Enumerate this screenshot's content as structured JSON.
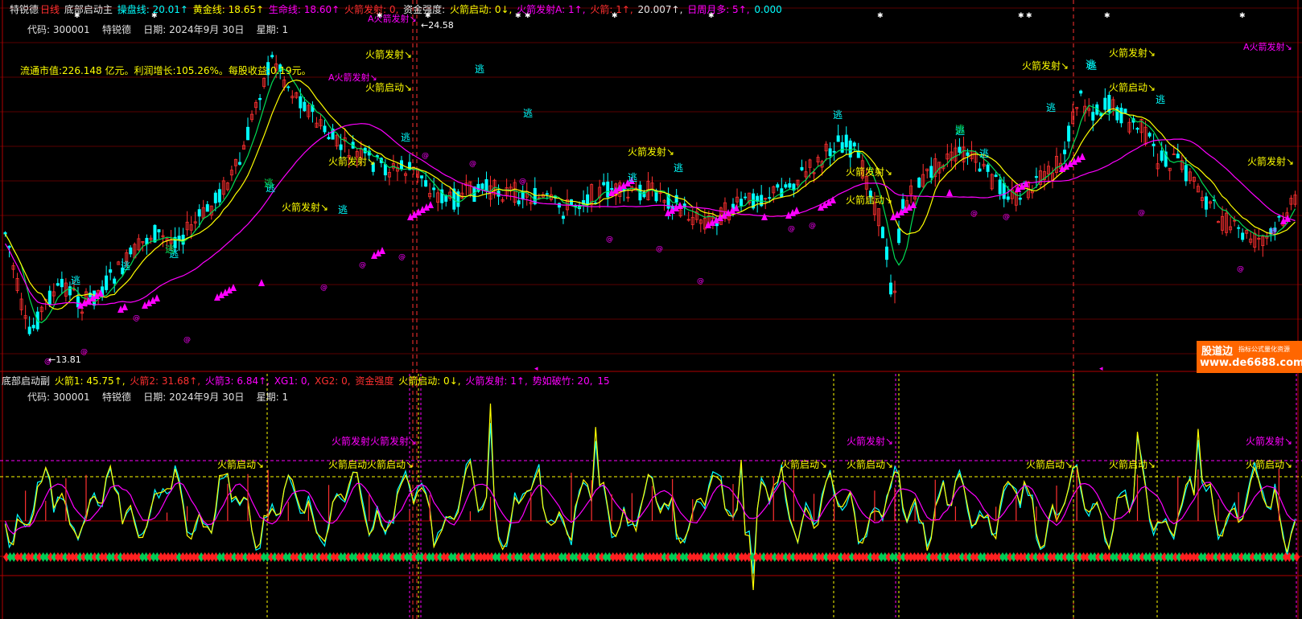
{
  "main_header": {
    "stock": "特锐德",
    "period": "日线",
    "indicator": "底部启动主",
    "items": [
      {
        "label": "操盘线:",
        "value": "20.01",
        "arrow": "↑",
        "color": "#00ffff"
      },
      {
        "label": "黄金线:",
        "value": "18.65",
        "arrow": "↑",
        "color": "#ffff00"
      },
      {
        "label": "生命线:",
        "value": "18.60",
        "arrow": "↑",
        "color": "#ff00ff"
      },
      {
        "label": "火箭发射:",
        "value": "0,",
        "arrow": "",
        "color": "#ff3030"
      },
      {
        "label": "资金强度:",
        "value": "",
        "arrow": "",
        "color": "#e8e8e8"
      },
      {
        "label": "火箭启动:",
        "value": "0",
        "arrow": "↓,",
        "color": "#ffff00"
      },
      {
        "label": "火箭发射A:",
        "value": "1",
        "arrow": "↑,",
        "color": "#ff00ff"
      },
      {
        "label": "火箭:",
        "value": "1",
        "arrow": "↑,",
        "color": "#ff3030"
      },
      {
        "label": "",
        "value": "20.007",
        "arrow": "↑,",
        "color": "#e8e8e8"
      },
      {
        "label": "日周月多:",
        "value": "5",
        "arrow": "↑,",
        "color": "#ff00ff"
      },
      {
        "label": "",
        "value": "0.000",
        "arrow": "",
        "color": "#00ffff"
      }
    ]
  },
  "main_info": {
    "code_label": "代码:",
    "code": "300001",
    "name": "特锐德",
    "date_label": "日期:",
    "date": "2024年9月 30日",
    "week_label": "星期:",
    "week": "1",
    "fundamentals": "流通市值:226.148 亿元。利润增长:105.26%。每股收益:0.19元。"
  },
  "sub_header": {
    "indicator": "底部启动副",
    "items": [
      {
        "label": "火箭1:",
        "value": "45.75",
        "arrow": "↑,",
        "color": "#ffff00"
      },
      {
        "label": "火箭2:",
        "value": "31.68",
        "arrow": "↑,",
        "color": "#ff3030"
      },
      {
        "label": "火箭3:",
        "value": "6.84",
        "arrow": "↑,",
        "color": "#ff00ff"
      },
      {
        "label": "XG1:",
        "value": "0,",
        "arrow": "",
        "color": "#ff00ff"
      },
      {
        "label": "XG2:",
        "value": "0,",
        "arrow": "",
        "color": "#ff3030"
      },
      {
        "label": "资金强度",
        "value": "",
        "arrow": "",
        "color": "#ff3030"
      },
      {
        "label": "火箭启动:",
        "value": "0",
        "arrow": "↓,",
        "color": "#ffff00"
      },
      {
        "label": "火箭发射:",
        "value": "1",
        "arrow": "↑,",
        "color": "#ff00ff"
      },
      {
        "label": "势如破竹:",
        "value": "20,",
        "arrow": "",
        "color": "#ff00ff"
      },
      {
        "label": "",
        "value": "15",
        "arrow": "",
        "color": "#ff00ff"
      }
    ]
  },
  "sub_info": {
    "code_label": "代码:",
    "code": "300001",
    "name": "特锐德",
    "date_label": "日期:",
    "date": "2024年9月 30日",
    "week_label": "星期:",
    "week": "1"
  },
  "brand": {
    "name": "股道边",
    "tagline": "指标公式量化资源",
    "url": "www.de6688.com"
  },
  "colors": {
    "up": "#ff3030",
    "down": "#00ffff",
    "yellow": "#ffff00",
    "magenta": "#ff00ff",
    "green": "#00cc44",
    "grid": "#8b0000",
    "brand": "#ff6600"
  },
  "chart_data": [
    {
      "type": "candlestick",
      "title": "底部启动主",
      "series": [
        {
          "name": "操盘线",
          "color": "#00ffff",
          "last": 20.01
        },
        {
          "name": "黄金线",
          "color": "#ffff00",
          "last": 18.65
        },
        {
          "name": "生命线",
          "color": "#ff00ff",
          "last": 18.6
        }
      ],
      "price_high_marker": "24.58",
      "price_low_marker": "13.81",
      "signal_labels": {
        "escape": "逃",
        "rocket_fire": "火箭发射↘",
        "rocket_start": "火箭启动↘",
        "rocket_fire_a": "A火箭发射↘",
        "at_mark": "@"
      }
    },
    {
      "type": "line",
      "title": "底部启动副",
      "series": [
        {
          "name": "火箭1",
          "color": "#ffff00",
          "last": 45.75
        },
        {
          "name": "火箭2",
          "color": "#ff3030",
          "last": 31.68
        },
        {
          "name": "火箭3",
          "color": "#ff00ff",
          "last": 6.84
        }
      ],
      "signal_labels": {
        "rocket_fire": "火箭发射↘",
        "rocket_start": "火箭启动↘",
        "overlap_fire": "火箭发射火箭发射↘",
        "overlap_start": "火箭启动火箭启动↘"
      }
    }
  ]
}
